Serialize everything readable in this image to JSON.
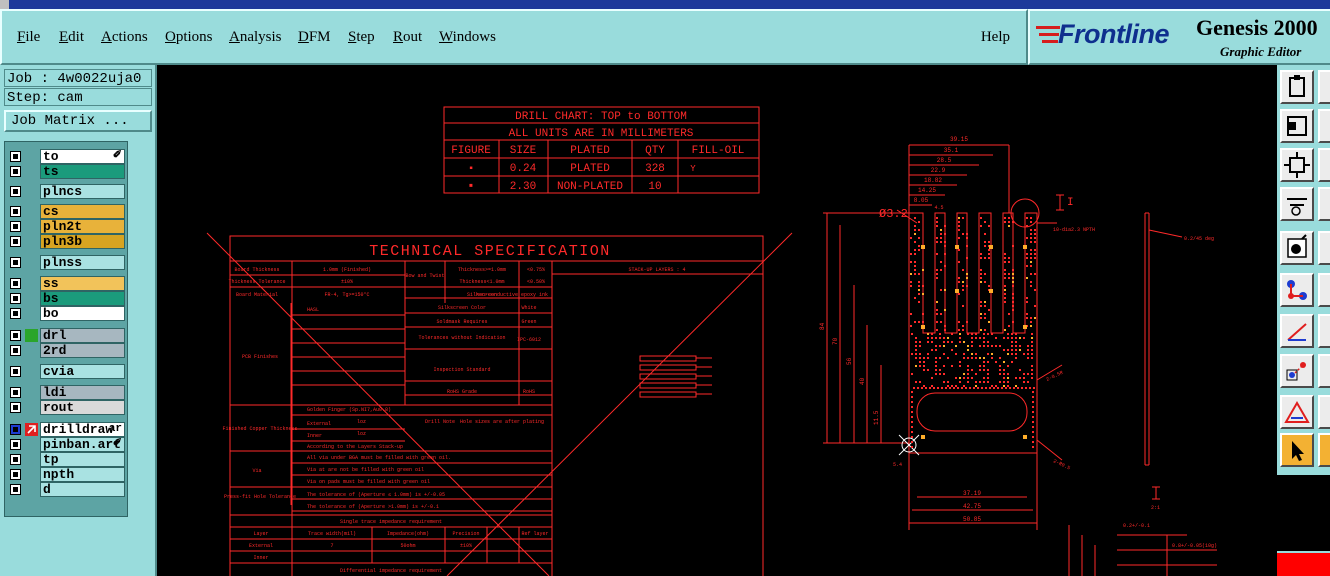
{
  "menubar": {
    "items": [
      "File",
      "Edit",
      "Actions",
      "Options",
      "Analysis",
      "DFM",
      "Step",
      "Rout",
      "Windows"
    ],
    "help": "Help"
  },
  "logo": {
    "brand": "Frontline",
    "product": "Genesis 2000",
    "subtitle": "Graphic Editor"
  },
  "left": {
    "job": "Job : 4w0022uja0",
    "step": "Step: cam",
    "job_matrix": "Job Matrix ...",
    "layers": [
      {
        "name": "to",
        "color": "#ffffff",
        "tail": "✐"
      },
      {
        "name": "ts",
        "color": "#1b9b7c",
        "tail": ""
      },
      {
        "name": "plncs",
        "color": "#a9e2e2",
        "tail": ""
      },
      {
        "name": "cs",
        "color": "#e8b23a",
        "tail": ""
      },
      {
        "name": "pln2t",
        "color": "#e8b23a",
        "tail": ""
      },
      {
        "name": "pln3b",
        "color": "#d7a421",
        "tail": ""
      },
      {
        "name": "plnss",
        "color": "#a9e2e2",
        "tail": ""
      },
      {
        "name": "ss",
        "color": "#f2c35a",
        "tail": ""
      },
      {
        "name": "bs",
        "color": "#1b9b7c",
        "tail": ""
      },
      {
        "name": "bo",
        "color": "#ffffff",
        "tail": ""
      },
      {
        "name": "drl",
        "color": "#a7b7c0",
        "tail": ""
      },
      {
        "name": "2rd",
        "color": "#a7b7c0",
        "tail": ""
      },
      {
        "name": "cvia",
        "color": "#a9e2e2",
        "tail": ""
      },
      {
        "name": "ldi",
        "color": "#a7b7c0",
        "tail": ""
      },
      {
        "name": "rout",
        "color": "#d9d9d9",
        "tail": ""
      },
      {
        "name": "drilldraw",
        "color": "#ffffff",
        "tail": "ar"
      },
      {
        "name": "pinban.art",
        "color": "#a9e2e2",
        "tail": "✐"
      },
      {
        "name": "tp",
        "color": "#a9e2e2",
        "tail": ""
      },
      {
        "name": "npth",
        "color": "#a9e2e2",
        "tail": ""
      },
      {
        "name": "d",
        "color": "#a9e2e2",
        "tail": ""
      }
    ]
  },
  "drill_chart": {
    "title1": "DRILL CHART: TOP to BOTTOM",
    "title2": "ALL UNITS ARE IN MILLIMETERS",
    "headers": [
      "FIGURE",
      "SIZE",
      "PLATED",
      "QTY",
      "FILL-OIL"
    ],
    "rows": [
      [
        "▪",
        "0.24",
        "PLATED",
        "328",
        "Y"
      ],
      [
        "▪",
        "2.30",
        "NON-PLATED",
        "10",
        ""
      ]
    ]
  },
  "tech_spec": {
    "title": "TECHNICAL SPECIFICATION",
    "left_rows": [
      "Board Thickness",
      "Thickness Tolerance",
      "Board Material",
      "PCB Finishes",
      "Finished Copper Thickness",
      "Via",
      "Press-fit Hole Tolerance"
    ],
    "values": [
      "1.0mm (Finished)",
      "±10%",
      "FR-4, Tg>=150°C"
    ],
    "mid_rows": [
      "Bow and Twist",
      "Silkscreen",
      "Silkscreen Color",
      "Soldmask Requires",
      "Tolerances without Indication",
      "Inspection Standard",
      "RoHS Grade",
      "Drill Note"
    ],
    "mid_values": [
      "Thickness>=1.0mm",
      "Thickness<1.0mm",
      "non-conductive epoxy ink",
      "White",
      "Green",
      "IPC-6012",
      "RoHS",
      "Hole sizes are after plating"
    ],
    "notes": [
      "HASL",
      "Golden Finger (Sp.NI7,Au0.8)",
      "External",
      "Inner",
      "According to the Layers Stack-up",
      "All via under BGA must be filled with green oil.",
      "Via at      are not be filled with green oil",
      "Via on pads must be filled with green oil",
      "The tolerance of   (Aperture ≤ 1.0mm) is +/-0.05",
      "The tolerance of   (Aperture >1.0mm) is +/-0.1"
    ],
    "stackup": "STACK-UP LAYERS : 4",
    "impedance_title": "Single trace impedance requirement",
    "impedance_headers": [
      "Layer",
      "Trace width(mil)",
      "Impedance(ohm)",
      "Precision",
      "Ref layer"
    ],
    "impedance_row": [
      "External",
      "7",
      "50ohm",
      "±10%",
      ""
    ],
    "impedance_row2": [
      "Inner"
    ],
    "differential": "Differential impedance requirement",
    "small_labels": [
      "loz",
      "loz",
      "<0.75%",
      "<0.50%"
    ]
  },
  "dims": {
    "dia": "Ø3.2",
    "top": [
      "39.15",
      "35.1",
      "28.5",
      "22.9",
      "18.82",
      "14.25",
      "8.05",
      "4.5"
    ],
    "side": [
      "84",
      "70",
      "56",
      "40",
      "11.5"
    ],
    "bottom": [
      "37.19",
      "42.75",
      "50.85"
    ],
    "misc": [
      "10-dia2.3 NPTH",
      "2-0.5R",
      "2-R0.5",
      "0.2/45 deg",
      "I",
      "2:1",
      "5.4",
      "0.2+/-0.1",
      "0.8+/-0.05(10g)"
    ]
  },
  "colors": {
    "drawing": "#ff2a2a",
    "teal": "#99dcdc",
    "via": "#ffae2a"
  },
  "icons": [
    "paste-icon",
    "open-view-icon",
    "fit-view-icon",
    "wrench-tool-icon",
    "gear-icon",
    "connect-nodes-icon",
    "measure-icon",
    "snap-icon",
    "drc-icon",
    "pointer-icon"
  ]
}
